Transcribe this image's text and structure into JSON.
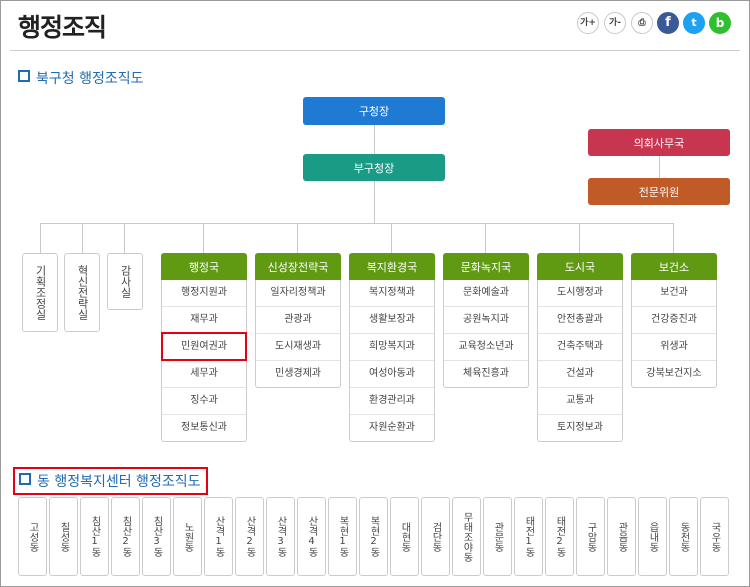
{
  "page": {
    "title": "행정조직"
  },
  "toolbar": {
    "font_larger": "가+",
    "font_smaller": "가-",
    "print": "⎙",
    "facebook": "f",
    "twitter": "t",
    "band": "b"
  },
  "sections": {
    "org_chart": "북구청 행정조직도",
    "dong_chart": "동 행정복지센터 행정조직도"
  },
  "top": {
    "head": "구청장",
    "deputy": "부구청장",
    "council": "의회사무국",
    "expert": "전문위원"
  },
  "side_units": [
    "기획조정실",
    "혁신전략실",
    "감사실"
  ],
  "departments": [
    {
      "name": "행정국",
      "units": [
        "행정지원과",
        "재무과",
        "민원여권과",
        "세무과",
        "징수과",
        "정보통신과"
      ]
    },
    {
      "name": "신성장전략국",
      "units": [
        "일자리정책과",
        "관광과",
        "도시재생과",
        "민생경제과"
      ]
    },
    {
      "name": "복지환경국",
      "units": [
        "복지정책과",
        "생활보장과",
        "희망복지과",
        "여성아동과",
        "환경관리과",
        "자원순환과"
      ]
    },
    {
      "name": "문화녹지국",
      "units": [
        "문화예술과",
        "공원녹지과",
        "교육청소년과",
        "체육진흥과"
      ]
    },
    {
      "name": "도시국",
      "units": [
        "도시행정과",
        "안전총괄과",
        "건축주택과",
        "건설과",
        "교통과",
        "토지정보과"
      ]
    },
    {
      "name": "보건소",
      "units": [
        "보건과",
        "건강증진과",
        "위생과",
        "강북보건지소"
      ]
    }
  ],
  "dongs": [
    "고성동",
    "칠성동",
    "침산1동",
    "침산2동",
    "침산3동",
    "노원동",
    "산격1동",
    "산격2동",
    "산격3동",
    "산격4동",
    "복현1동",
    "복현2동",
    "대현동",
    "검단동",
    "무태조야동",
    "관문동",
    "태전1동",
    "태전2동",
    "구암동",
    "관음동",
    "읍내동",
    "동천동",
    "국우동"
  ],
  "colors": {
    "head": "#1f7ad4",
    "deputy": "#1a9b86",
    "council": "#c8354f",
    "expert": "#c05a26",
    "dept": "#5f9a12",
    "highlight": "#e60012",
    "section": "#1f6bb5"
  }
}
